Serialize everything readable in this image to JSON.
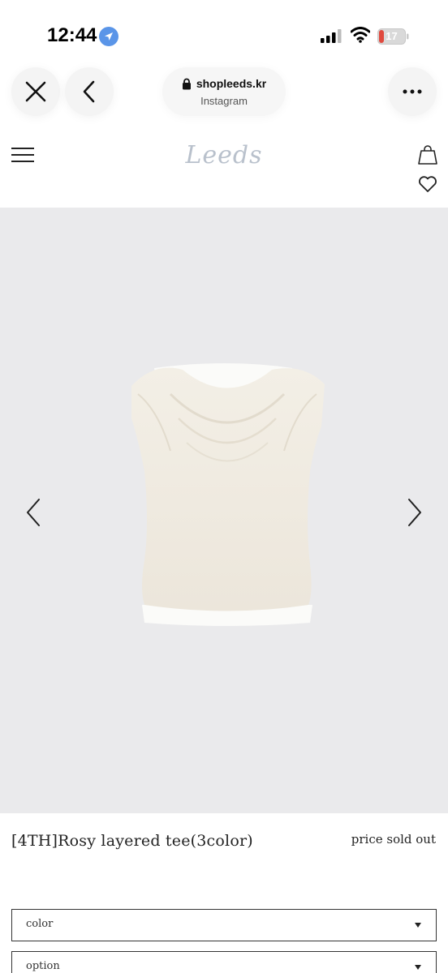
{
  "status_bar": {
    "time": "12:44",
    "battery": "17"
  },
  "browser": {
    "domain": "shopleeds.kr",
    "source": "Instagram"
  },
  "site": {
    "logo": "Leeds"
  },
  "product": {
    "name": "[4TH]Rosy layered tee(3color)",
    "price_status": "price sold out",
    "selects": [
      {
        "label": "color"
      },
      {
        "label": "option"
      }
    ]
  },
  "icons": {
    "close": "close-icon",
    "back": "chevron-left-icon",
    "lock": "lock-icon",
    "more": "more-icon",
    "menu": "hamburger-icon",
    "bag": "shopping-bag-icon",
    "heart": "heart-icon",
    "prev": "chevron-left-icon",
    "next": "chevron-right-icon",
    "caret": "caret-down-icon"
  },
  "colors": {
    "image_bg": "#eaeaec",
    "garment": "#f1ece3",
    "logo": "#b9c1cc",
    "location_badge": "#5a95e8",
    "battery_low": "#e04a3f"
  }
}
